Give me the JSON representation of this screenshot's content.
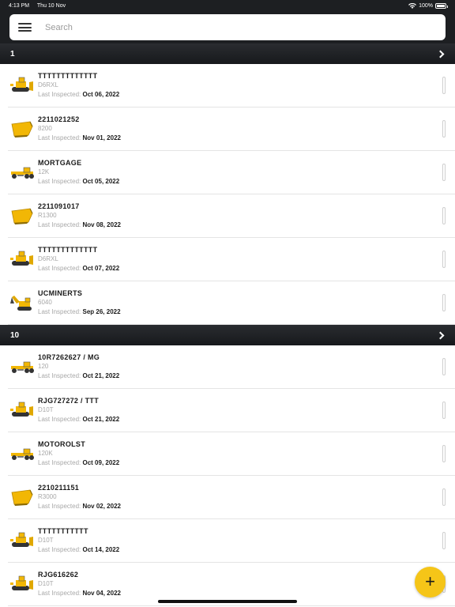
{
  "status": {
    "time": "4:13 PM",
    "date": "Thu 10 Nov",
    "battery": "100%"
  },
  "search": {
    "placeholder": "Search"
  },
  "groups": [
    {
      "title": "1",
      "items": [
        {
          "name": "TTTTTTTTTTTTT",
          "model": "D6RXL",
          "label": "Last Inspected:",
          "date": "Oct 06, 2022",
          "icon": "dozer-icon"
        },
        {
          "name": "2211021252",
          "model": "8200",
          "label": "Last Inspected:",
          "date": "Nov 01, 2022",
          "icon": "bucket-icon"
        },
        {
          "name": "MORTGAGE",
          "model": "12K",
          "label": "Last Inspected:",
          "date": "Oct 05, 2022",
          "icon": "grader-icon"
        },
        {
          "name": "2211091017",
          "model": "R1300",
          "label": "Last Inspected:",
          "date": "Nov 08, 2022",
          "icon": "bucket-icon"
        },
        {
          "name": "TTTTTTTTTTTTT",
          "model": "D6RXL",
          "label": "Last Inspected:",
          "date": "Oct 07, 2022",
          "icon": "dozer-icon"
        },
        {
          "name": "UCMINERTS",
          "model": "6040",
          "label": "Last Inspected:",
          "date": "Sep 26, 2022",
          "icon": "excavator-icon"
        }
      ]
    },
    {
      "title": "10",
      "items": [
        {
          "name": "10R7262627 / MG",
          "model": "120",
          "label": "Last Inspected:",
          "date": "Oct 21, 2022",
          "icon": "grader-icon"
        },
        {
          "name": "RJG727272 / TTT",
          "model": "D10T",
          "label": "Last Inspected:",
          "date": "Oct 21, 2022",
          "icon": "dozer-icon"
        },
        {
          "name": "MOTOROLST",
          "model": "120K",
          "label": "Last Inspected:",
          "date": "Oct 09, 2022",
          "icon": "grader-icon"
        },
        {
          "name": "2210211151",
          "model": "R3000",
          "label": "Last Inspected:",
          "date": "Nov 02, 2022",
          "icon": "bucket-icon"
        },
        {
          "name": "TTTTTTTTTTT",
          "model": "D10T",
          "label": "Last Inspected:",
          "date": "Oct 14, 2022",
          "icon": "dozer-icon"
        },
        {
          "name": "RJG616262",
          "model": "D10T",
          "label": "Last Inspected:",
          "date": "Nov 04, 2022",
          "icon": "dozer-icon"
        }
      ]
    }
  ],
  "fab": {
    "label": "+"
  },
  "colors": {
    "accent": "#f5c518",
    "header": "#1d1f22"
  }
}
